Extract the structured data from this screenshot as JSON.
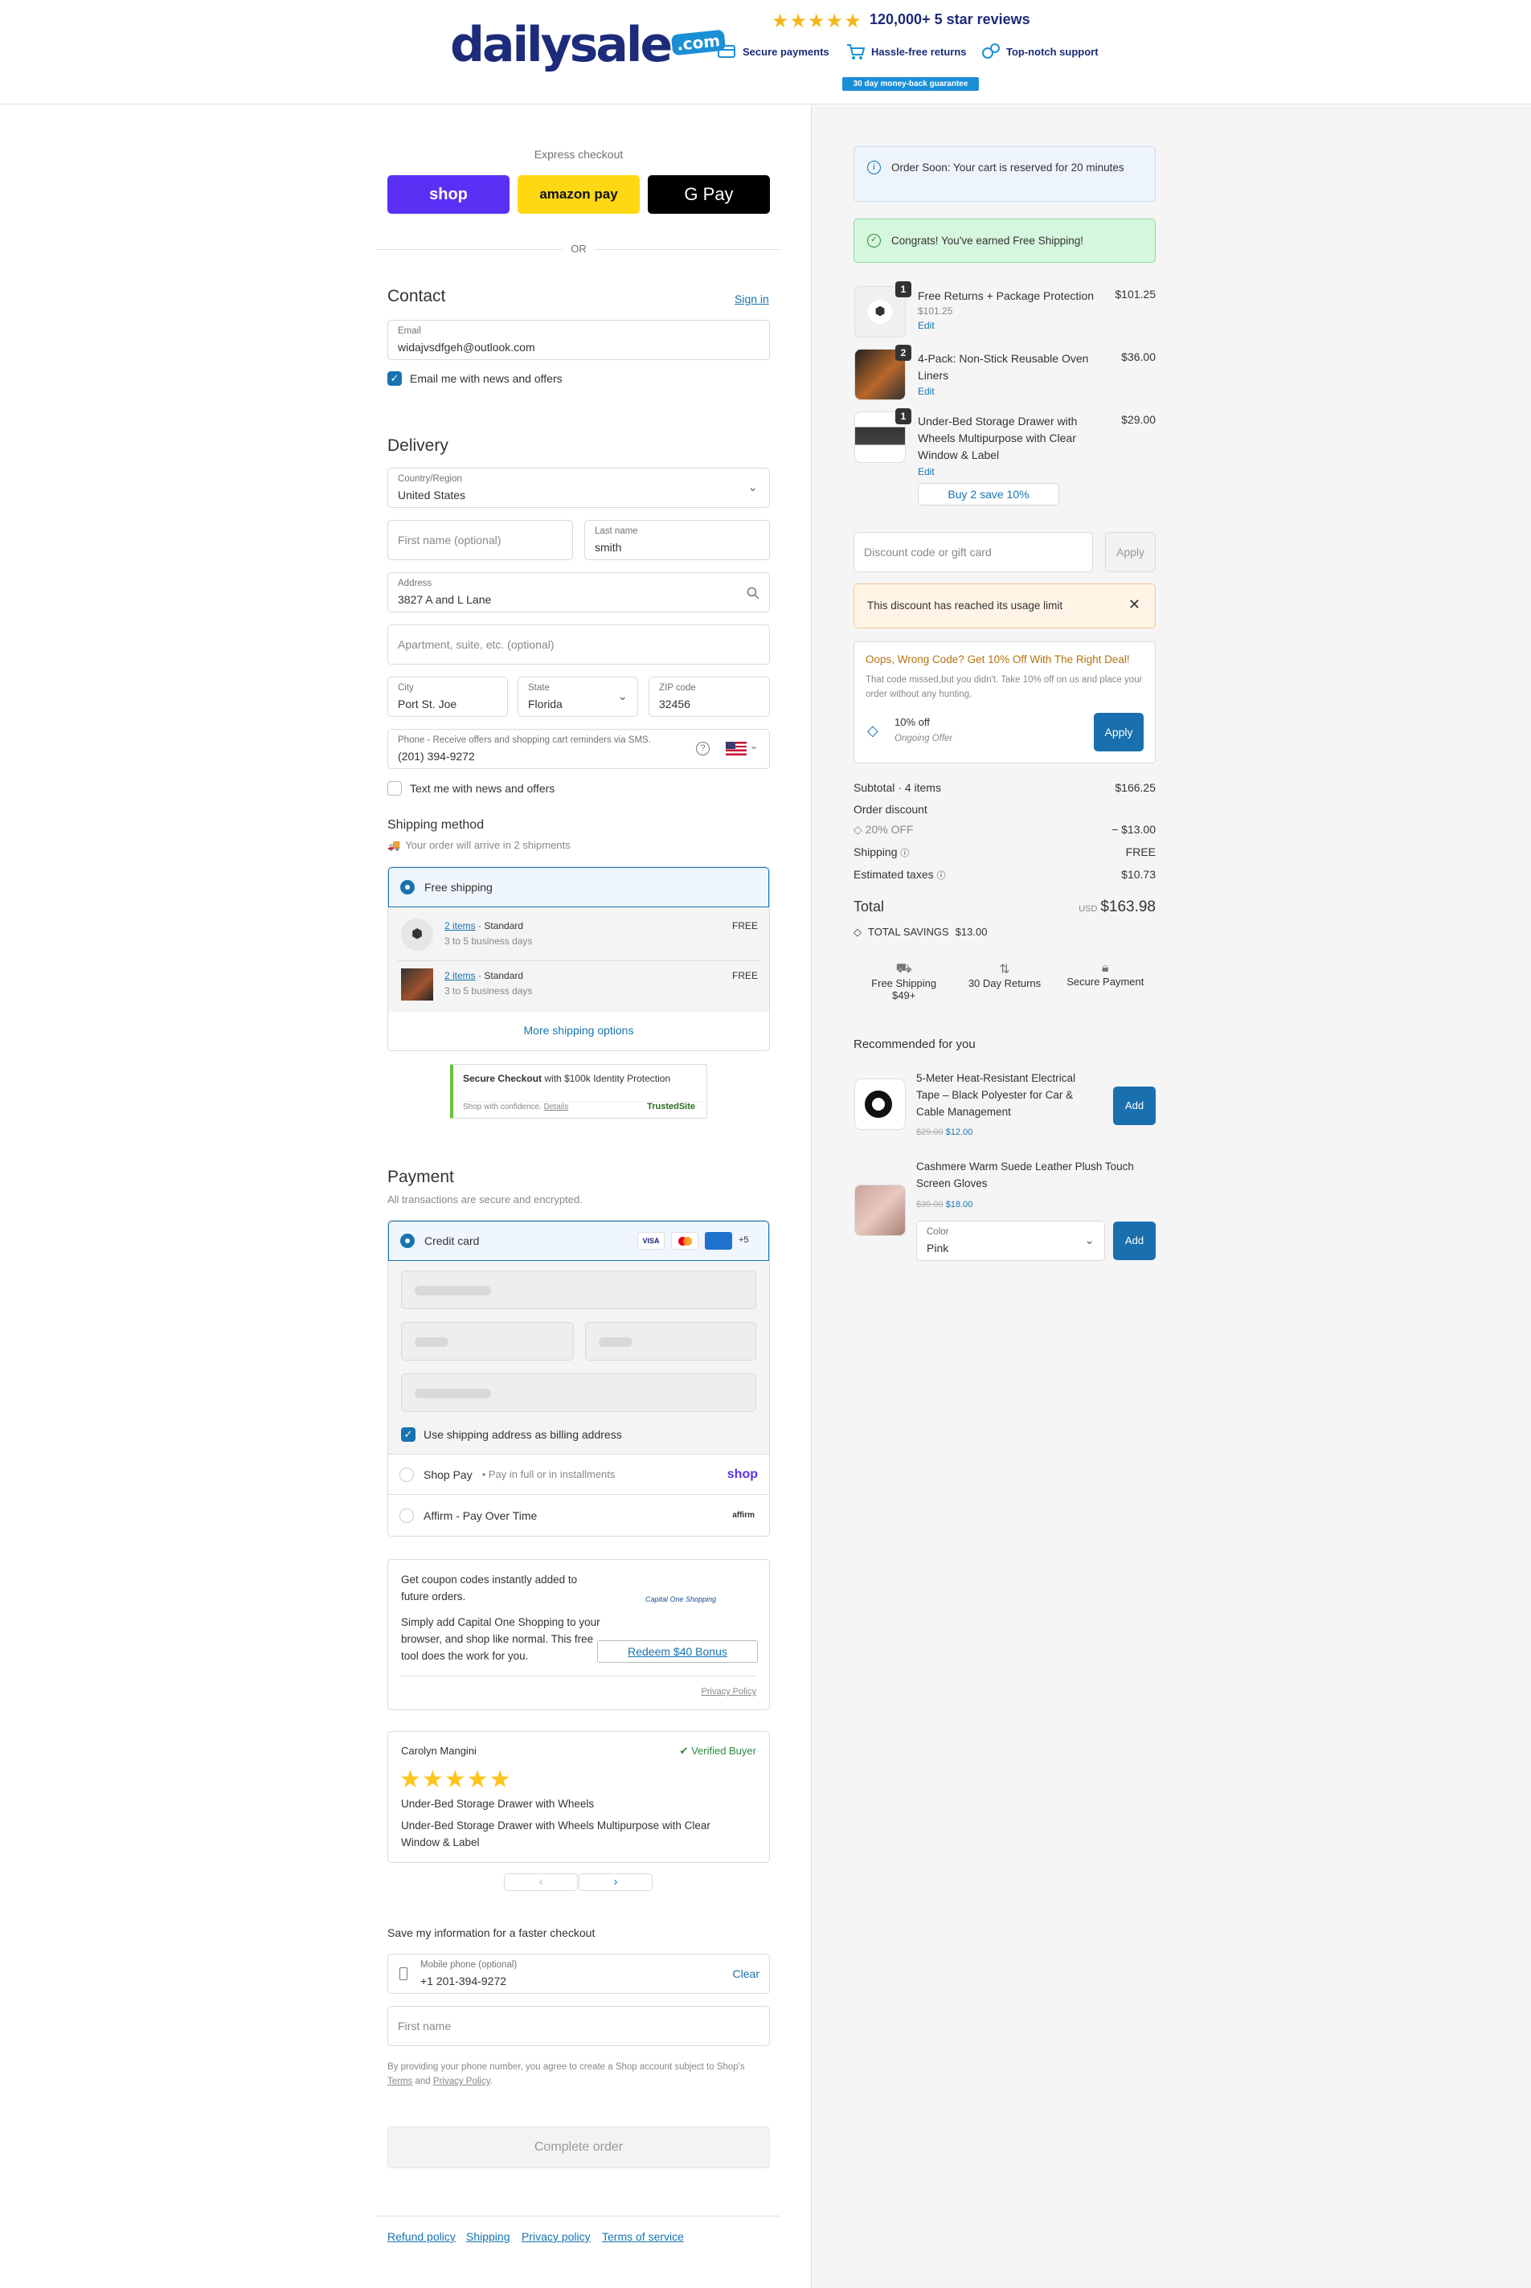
{
  "header": {
    "logo_text": "dailysale",
    "logo_suffix": ".com",
    "stars": "★★★★★",
    "reviews": "120,000+ 5 star reviews",
    "badges": [
      "Secure payments",
      "Hassle-free returns",
      "Top-notch support"
    ],
    "guarantee": "30 day money-back guarantee"
  },
  "express": {
    "label": "Express checkout",
    "shop": "shop",
    "amazon": "amazon pay",
    "gpay": "G Pay",
    "or": "OR"
  },
  "contact": {
    "title": "Contact",
    "sign_in": "Sign in",
    "email_label": "Email",
    "email_value": "widajvsdfgeh@outlook.com",
    "news_label": "Email me with news and offers"
  },
  "delivery": {
    "title": "Delivery",
    "country_label": "Country/Region",
    "country_value": "United States",
    "first_name_placeholder": "First name (optional)",
    "last_name_label": "Last name",
    "last_name_value": "smith",
    "address_label": "Address",
    "address_value": "3827 A and L Lane",
    "apt_placeholder": "Apartment, suite, etc. (optional)",
    "city_label": "City",
    "city_value": "Port St. Joe",
    "state_label": "State",
    "state_value": "Florida",
    "zip_label": "ZIP code",
    "zip_value": "32456",
    "phone_label": "Phone - Receive offers and shopping cart reminders via SMS.",
    "phone_value": "(201) 394-9272",
    "text_label": "Text me with news and offers"
  },
  "shipping": {
    "title": "Shipping method",
    "subtitle": "Your order will arrive in 2 shipments",
    "option": "Free shipping",
    "shipments": [
      {
        "items": "2 items",
        "type": "Standard",
        "eta": "3 to 5 business days",
        "price": "FREE"
      },
      {
        "items": "2 items",
        "type": "Standard",
        "eta": "3 to 5 business days",
        "price": "FREE"
      }
    ],
    "more": "More shipping options"
  },
  "trusted": {
    "title": "Secure Checkout",
    "subtitle": "with $100k Identity Protection",
    "line": "Shop with confidence.",
    "details": "Details",
    "brand": "TrustedSite"
  },
  "payment": {
    "title": "Payment",
    "subtitle": "All transactions are secure and encrypted.",
    "credit_card": "Credit card",
    "card_more": "+5",
    "billing_label": "Use shipping address as billing address",
    "shop_pay": "Shop Pay",
    "shop_pay_sub": "Pay in full or in installments",
    "shop_logo": "shop",
    "affirm": "Affirm - Pay Over Time",
    "affirm_logo": "affirm"
  },
  "capone": {
    "line1": "Get coupon codes instantly added to future orders.",
    "line2": "Simply add Capital One Shopping to your browser, and shop like normal. This free tool does the work for you.",
    "logo": "Capital One Shopping",
    "redeem": "Redeem $40 Bonus",
    "privacy": "Privacy Policy"
  },
  "review": {
    "name": "Carolyn Mangini",
    "verified": "Verified Buyer",
    "stars": "★★★★★",
    "title": "Under-Bed Storage Drawer with Wheels",
    "body": "Under-Bed Storage Drawer with Wheels Multipurpose with Clear Window & Label",
    "prev": "‹",
    "next": "›"
  },
  "save_info": {
    "title": "Save my information for a faster checkout",
    "phone_label": "Mobile phone (optional)",
    "phone_value": "+1 201-394-9272",
    "clear": "Clear",
    "first_name_placeholder": "First name",
    "disclaimer_pre": "By providing your phone number, you agree to create a Shop account subject to Shop's",
    "terms": "Terms",
    "and": "and",
    "privacy": "Privacy Policy",
    "period": "."
  },
  "complete": "Complete order",
  "footer_links": [
    "Refund policy",
    "Shipping",
    "Privacy policy",
    "Terms of service"
  ],
  "summary": {
    "reserved": "Order Soon: Your cart is reserved for 20 minutes",
    "free_shipping_msg": "Congrats! You've earned Free Shipping!",
    "items": [
      {
        "qty": "1",
        "title": "Free Returns + Package Protection",
        "sub": "$101.25",
        "edit": "Edit",
        "price": "$101.25"
      },
      {
        "qty": "2",
        "title": "4-Pack: Non-Stick Reusable Oven Liners",
        "edit": "Edit",
        "price": "$36.00"
      },
      {
        "qty": "1",
        "title": "Under-Bed Storage Drawer with Wheels Multipurpose with Clear Window & Label",
        "edit": "Edit",
        "price": "$29.00",
        "offer": "Buy 2 save 10%"
      }
    ],
    "discount_placeholder": "Discount code or gift card",
    "apply": "Apply",
    "limit_msg": "This discount has reached its usage limit",
    "oops_title": "Oops, Wrong Code? Get 10% Off With The Right Deal!",
    "oops_body": "That code missed,but you didn't. Take 10% off on us and place your order without any hunting.",
    "offer_title": "10% off",
    "offer_sub": "Ongoing Offer",
    "offer_apply": "Apply",
    "subtotal_label": "Subtotal · 4 items",
    "subtotal": "$166.25",
    "order_discount": "Order discount",
    "discount_code": "20% OFF",
    "discount_value": "− $13.00",
    "shipping_label": "Shipping",
    "shipping_value": "FREE",
    "taxes_label": "Estimated taxes",
    "taxes_value": "$10.73",
    "total_label": "Total",
    "currency": "USD",
    "total": "$163.98",
    "savings_label": "TOTAL SAVINGS",
    "savings": "$13.00",
    "perks": [
      "Free Shipping $49+",
      "30 Day Returns",
      "Secure Payment"
    ]
  },
  "recommended": {
    "title": "Recommended for you",
    "items": [
      {
        "title": "5-Meter Heat-Resistant Electrical Tape – Black Polyester for Car & Cable Management",
        "old": "$29.00",
        "price": "$12.00",
        "add": "Add"
      },
      {
        "title": "Cashmere Warm Suede Leather Plush Touch Screen Gloves",
        "old": "$39.00",
        "price": "$18.00",
        "color_label": "Color",
        "color_value": "Pink",
        "add": "Add"
      }
    ]
  },
  "colors": {
    "accent": "#1773b0",
    "shop_purple": "#5a31f4",
    "amazon_yellow": "#ffd814",
    "brand_navy": "#1c2b7a"
  }
}
